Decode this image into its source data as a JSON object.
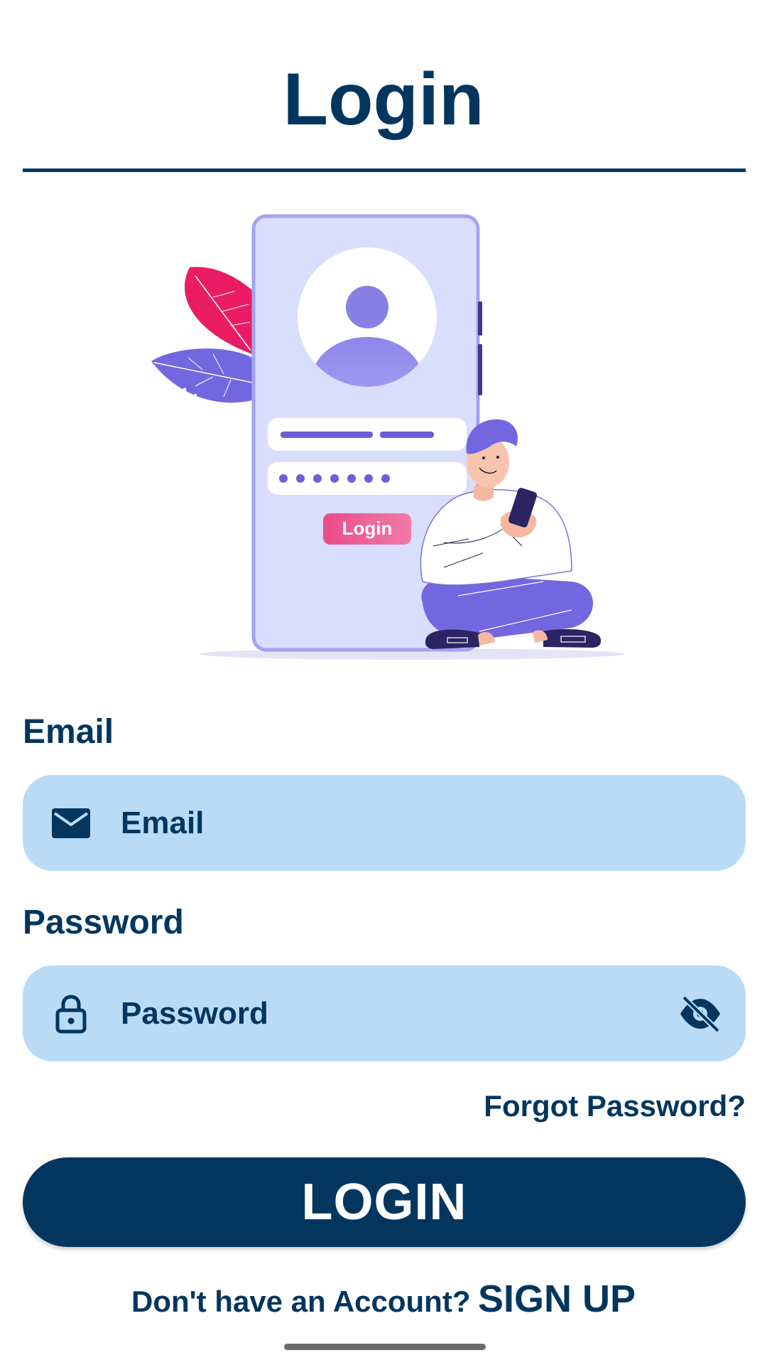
{
  "header": {
    "title": "Login"
  },
  "illustration": {
    "phone_button_label": "Login"
  },
  "form": {
    "email": {
      "label": "Email",
      "placeholder": "Email",
      "icon": "mail-icon"
    },
    "password": {
      "label": "Password",
      "placeholder": "Password",
      "icon": "lock-icon",
      "toggle_icon": "eye-off-icon"
    },
    "forgot_password": "Forgot Password?",
    "login_button": "LOGIN"
  },
  "footer": {
    "prompt": "Don't have an Account?",
    "signup_link": "SIGN UP"
  },
  "colors": {
    "primary": "#03365f",
    "input_background": "#b9dbf6",
    "illustration_purple": "#7367e0",
    "illustration_pink": "#ea1c63"
  }
}
